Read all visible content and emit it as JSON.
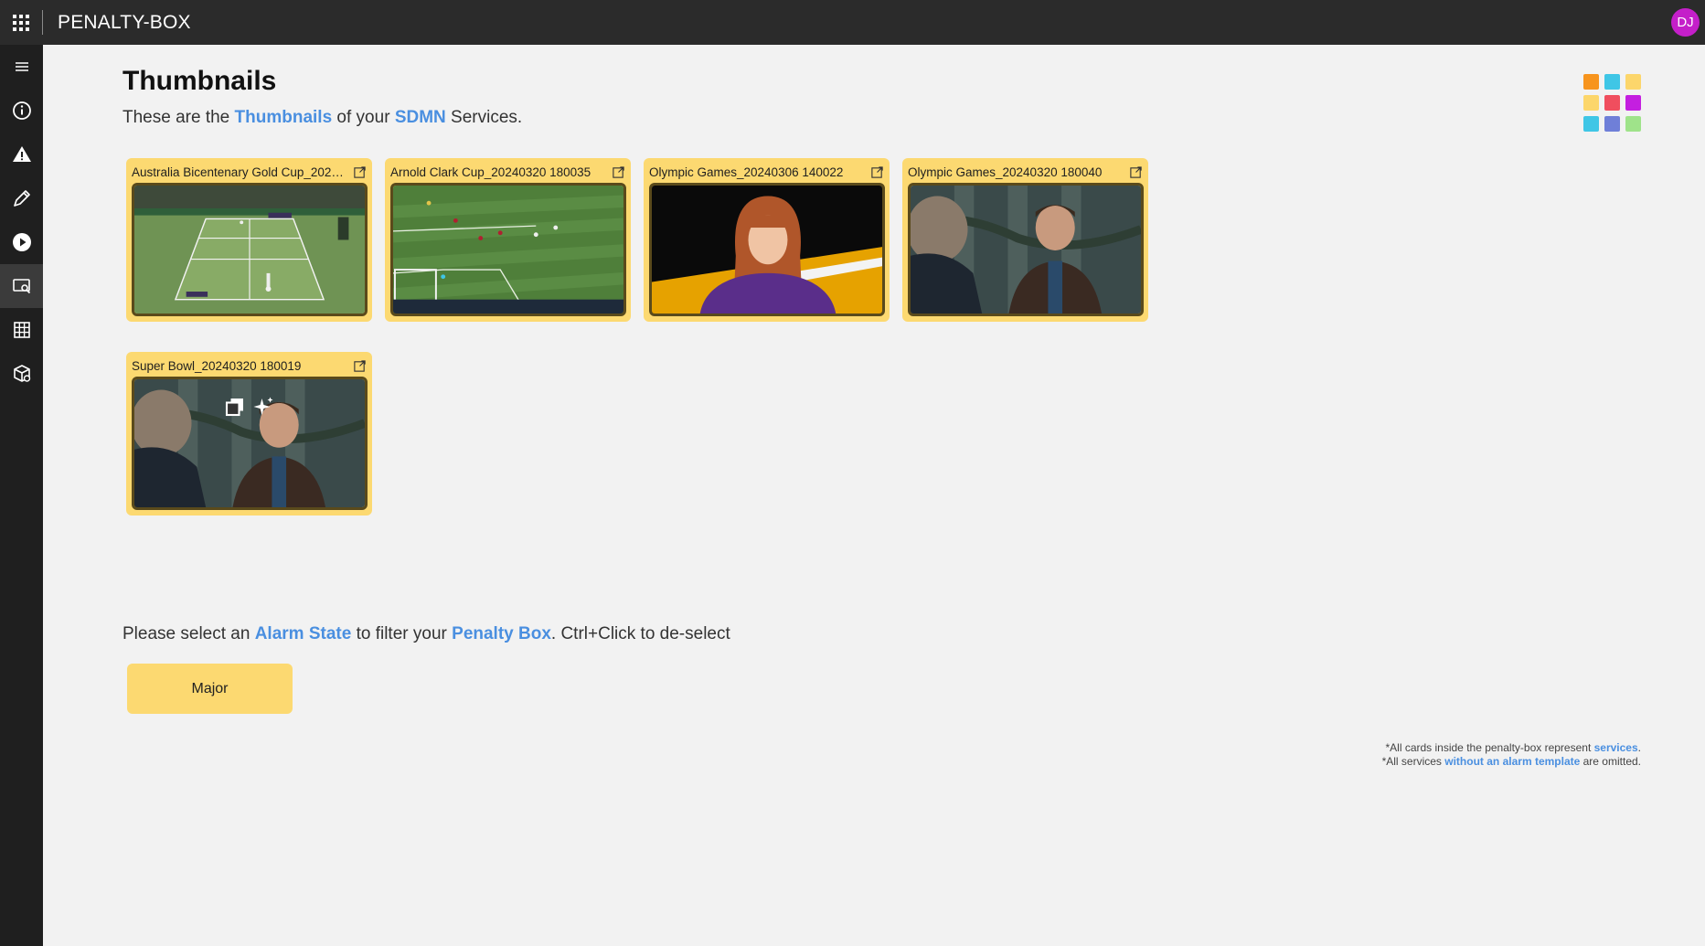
{
  "header": {
    "app_title": "PENALTY-BOX",
    "avatar_initials": "DJ",
    "avatar_color": "#c41fc9"
  },
  "sidebar": {
    "items": [
      {
        "icon": "hamburger-menu-icon"
      },
      {
        "icon": "info-icon"
      },
      {
        "icon": "warning-icon"
      },
      {
        "icon": "pencil-icon"
      },
      {
        "icon": "play-icon"
      },
      {
        "icon": "thumbnail-search-icon",
        "active": true
      },
      {
        "icon": "grid-table-icon"
      },
      {
        "icon": "package-icon"
      }
    ]
  },
  "page": {
    "title": "Thumbnails",
    "subtitle_pre": "These are the ",
    "subtitle_hl1": "Thumbnails",
    "subtitle_mid": " of your ",
    "subtitle_hl2": "SDMN",
    "subtitle_post": " Services."
  },
  "logo_colors": [
    "#f7941d",
    "#3fc6e6",
    "#fcd66b",
    "#fcd66b",
    "#f04e5e",
    "#c41fe0",
    "#3fc6e6",
    "#6f7fd8",
    "#9fe38a"
  ],
  "cards": [
    {
      "title": "Australia Bicentenary Gold Cup_2024...",
      "scene": "tennis"
    },
    {
      "title": "Arnold Clark Cup_20240320 180035",
      "scene": "soccer"
    },
    {
      "title": "Olympic Games_20240306 140022",
      "scene": "presenter"
    },
    {
      "title": "Olympic Games_20240320 180040",
      "scene": "drama"
    },
    {
      "title": "Super Bowl_20240320 180019",
      "scene": "drama"
    }
  ],
  "thumb_overlays": {
    "left_icon": "copy-image-icon",
    "right_icon": "sparkle-icon"
  },
  "filter": {
    "pre": "Please select an ",
    "hl1": "Alarm State",
    "mid": " to filter your ",
    "hl2": "Penalty Box",
    "post": ". Ctrl+Click to de-select",
    "states": [
      "Major"
    ],
    "state_color": "#fcd971"
  },
  "footnote": {
    "line1_pre": "*All cards inside the penalty-box represent ",
    "line1_hl": "services",
    "line1_post": ".",
    "line2_pre": "*All services ",
    "line2_hl": "without an alarm template",
    "line2_post": " are omitted."
  },
  "colors": {
    "accent": "#4a8fe0",
    "topbar": "#2b2b2b",
    "sidebar": "#1f1f1f",
    "card": "#fcd971"
  }
}
